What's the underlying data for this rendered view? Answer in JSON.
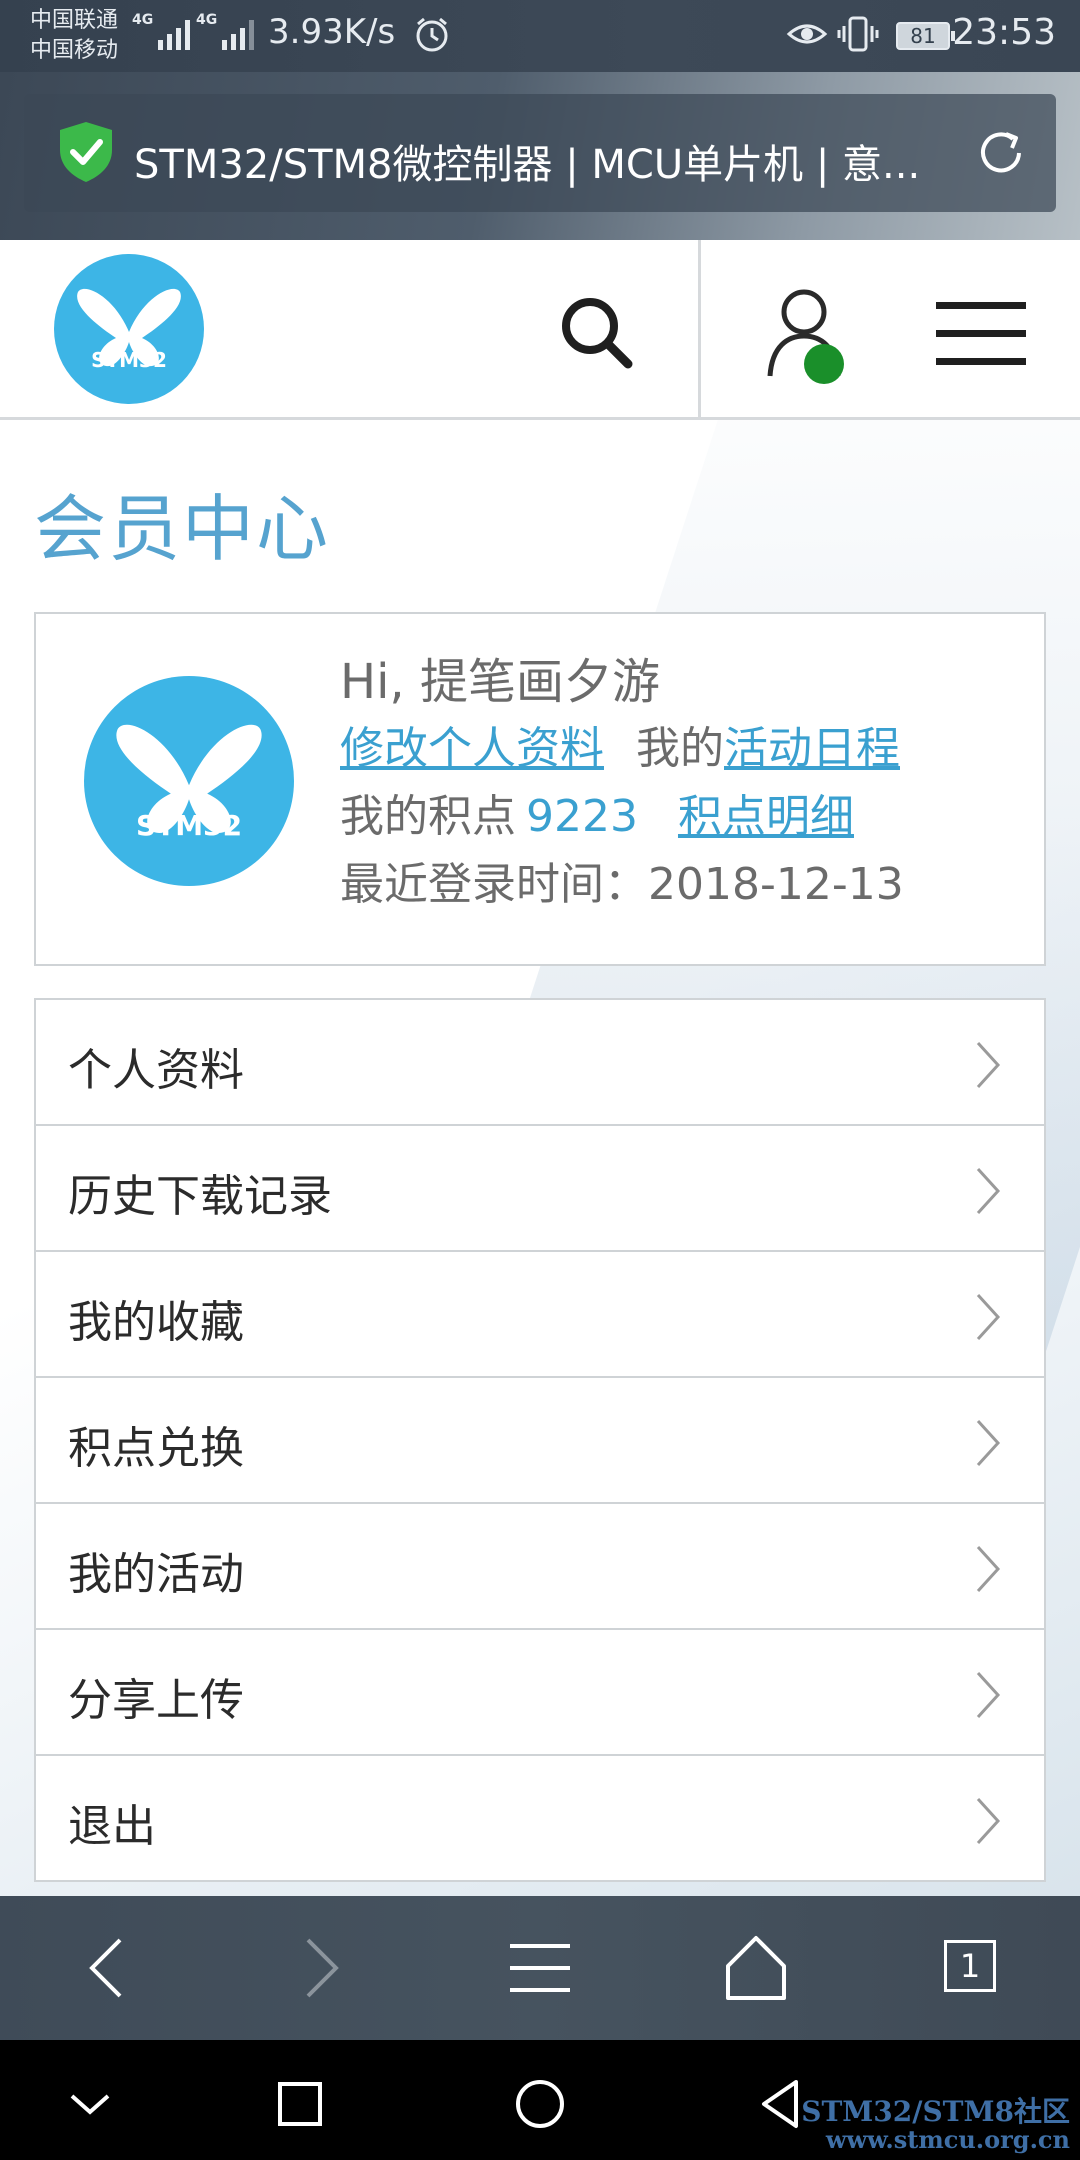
{
  "status_bar": {
    "carrier_1": "中国联通",
    "carrier_2": "中国移动",
    "net_tag": "4G",
    "net_speed": "3.93K/s",
    "battery": "81",
    "time": "23:53"
  },
  "browser": {
    "page_title": "STM32/STM8微控制器 | MCU单片机 | 意...",
    "tab_count": "1"
  },
  "site": {
    "logo_text": "STM32"
  },
  "page": {
    "title": "会员中心"
  },
  "profile": {
    "greeting": "Hi, 提笔画夕游",
    "edit_profile": "修改个人资料",
    "my_prefix": "我的",
    "activity_schedule": "活动日程",
    "points_label": "我的积点",
    "points_value": "9223",
    "points_detail": "积点明细",
    "last_login": "最近登录时间：2018-12-13"
  },
  "menu": [
    {
      "label": "个人资料"
    },
    {
      "label": "历史下载记录"
    },
    {
      "label": "我的收藏"
    },
    {
      "label": "积点兑换"
    },
    {
      "label": "我的活动"
    },
    {
      "label": "分享上传"
    },
    {
      "label": "退出"
    }
  ],
  "watermark": {
    "line1": "STM32/STM8社区",
    "line2": "www.stmcu.org.cn"
  },
  "colors": {
    "accent": "#3aa0d0",
    "title": "#56a3cf",
    "logo": "#3db5e6",
    "online": "#1a8f2a"
  }
}
